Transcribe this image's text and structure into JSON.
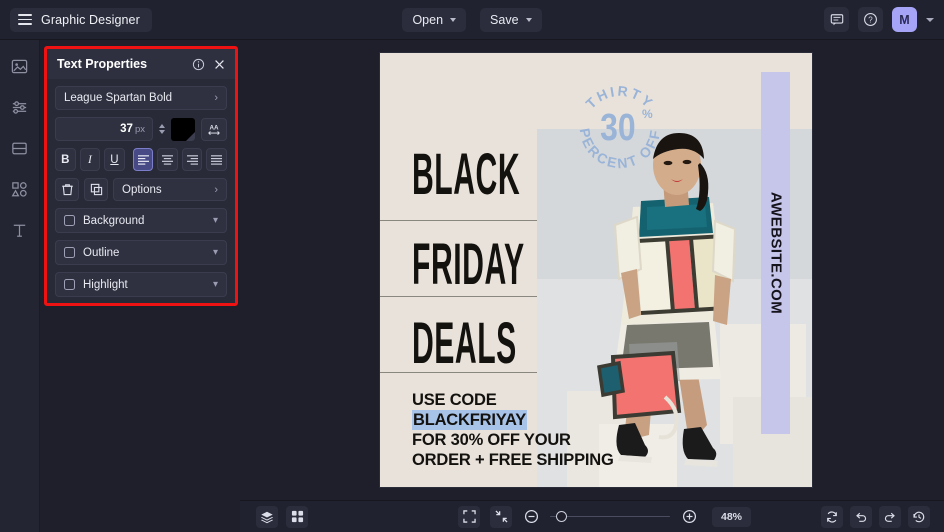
{
  "app": {
    "title": "Graphic Designer",
    "menu_icon": "hamburger-icon"
  },
  "topbar": {
    "open_label": "Open",
    "save_label": "Save",
    "comment_icon": "comment-icon",
    "help_icon": "help-circle-icon",
    "avatar_initial": "M",
    "accent_avatar": "#a6a4f7"
  },
  "rail": {
    "items": [
      {
        "name": "image-icon",
        "label": "Image"
      },
      {
        "name": "adjustments-icon",
        "label": "Adjust"
      },
      {
        "name": "layout-icon",
        "label": "Layout"
      },
      {
        "name": "shapes-icon",
        "label": "Shapes"
      },
      {
        "name": "text-icon",
        "label": "Text"
      }
    ]
  },
  "panel": {
    "title": "Text Properties",
    "highlight_color": "#ee1212",
    "info_icon": "info-circle-icon",
    "close_icon": "close-icon",
    "font_family": "League Spartan Bold",
    "font_size": "37",
    "font_size_unit": "px",
    "color_swatch": "#000000",
    "letter_spacing_icon": "letter-spacing-icon",
    "style_buttons": [
      {
        "name": "bold-button",
        "label": "B"
      },
      {
        "name": "italic-button",
        "label": "I"
      },
      {
        "name": "underline-button",
        "label": "U"
      }
    ],
    "align_buttons": [
      {
        "name": "align-left-button",
        "active": true
      },
      {
        "name": "align-center-button",
        "active": false
      },
      {
        "name": "align-right-button",
        "active": false
      },
      {
        "name": "align-justify-button",
        "active": false
      }
    ],
    "delete_icon": "trash-icon",
    "duplicate_icon": "duplicate-icon",
    "options_label": "Options",
    "toggles": [
      {
        "label": "Background",
        "checked": false
      },
      {
        "label": "Outline",
        "checked": false
      },
      {
        "label": "Highlight",
        "checked": false
      }
    ]
  },
  "canvas": {
    "background": "#e8e2da",
    "headline_lines": [
      "BLACK",
      "FRIDAY",
      "DEALS"
    ],
    "badge": {
      "top_arc": "THIRTY",
      "center": "30",
      "center_suffix": "%",
      "bottom_arc": "PERCENT OFF",
      "color": "#9ab4d8"
    },
    "sidebar_text": "AWEBSITE.COM",
    "sidebar_color": "#c6c5ea",
    "promo_lines": [
      "USE CODE",
      "BLACKFRIYAY",
      "FOR 30% OFF YOUR",
      "ORDER + FREE SHIPPING"
    ],
    "promo_highlight_index": 1,
    "promo_highlight_color": "#a8c3e8"
  },
  "bottombar": {
    "layers_icon": "layers-icon",
    "grid_icon": "grid-icon",
    "fit_icon": "fit-screen-icon",
    "shrink_icon": "shrink-icon",
    "zoom_out_icon": "zoom-out-icon",
    "zoom_in_icon": "zoom-in-icon",
    "zoom_level": "48%",
    "sync_icon": "sync-icon",
    "undo_icon": "undo-icon",
    "redo_icon": "redo-icon",
    "history_icon": "history-icon"
  }
}
